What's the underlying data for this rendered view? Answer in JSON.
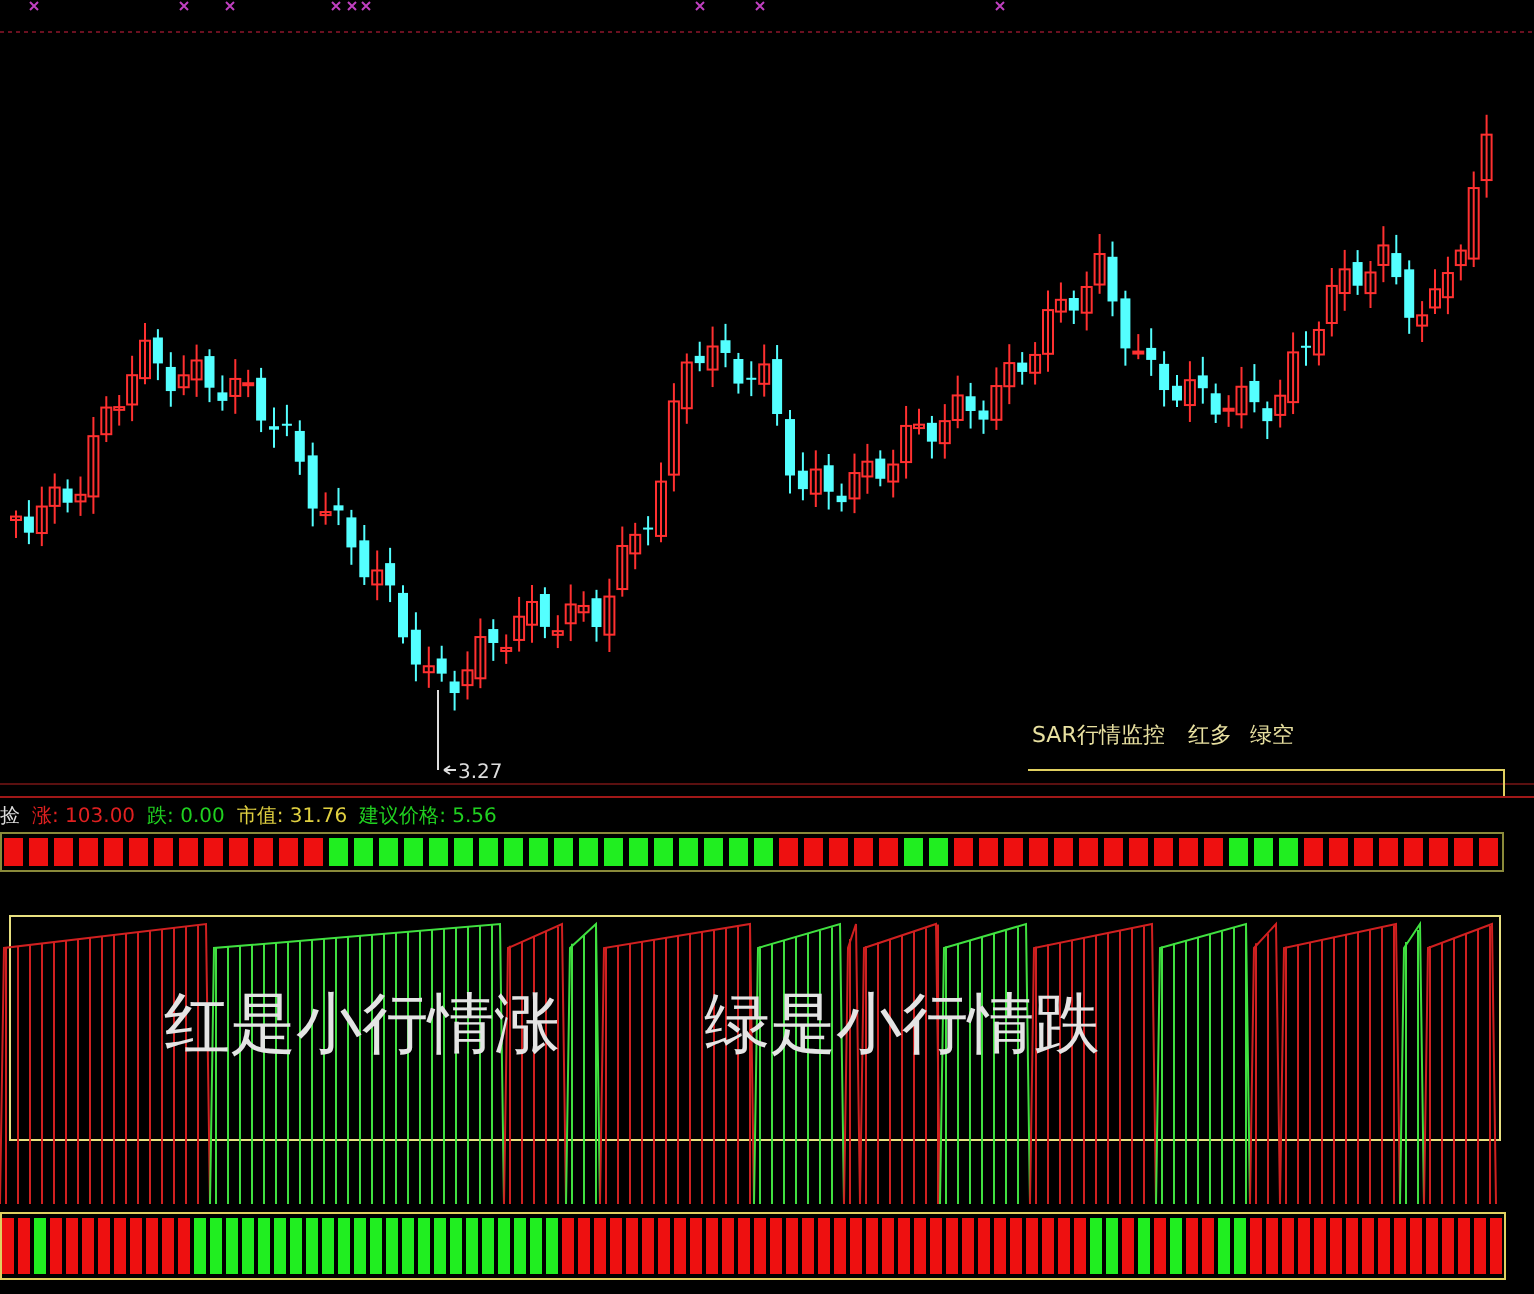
{
  "price_chart": {
    "low_marker": "3.27",
    "sar_title": "SAR行情监控",
    "sar_legend": [
      "红多",
      "绿空"
    ]
  },
  "indicator_row": {
    "label": "捡",
    "items": [
      {
        "text": "涨: 103.00",
        "color": "#e02020"
      },
      {
        "text": "跌: 0.00",
        "color": "#20d020"
      },
      {
        "text": "市值: 31.76",
        "color": "#e0d040"
      },
      {
        "text": "建议价格: 5.56",
        "color": "#20d020"
      }
    ]
  },
  "wave_panel": {
    "captions": [
      "红是小行情涨",
      "绿是小行情跌"
    ]
  }
}
